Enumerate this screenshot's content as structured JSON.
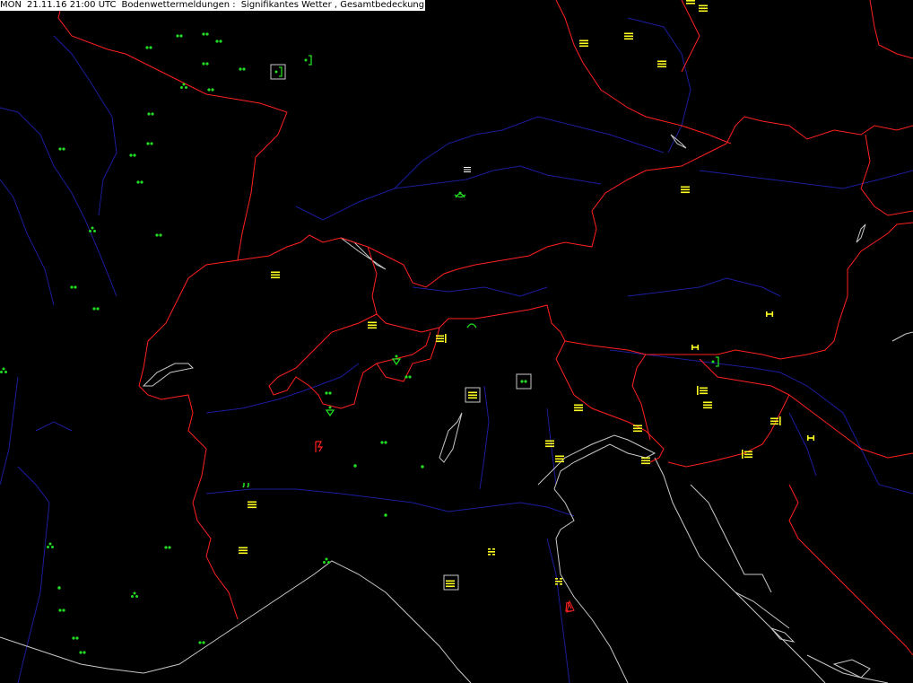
{
  "header": {
    "day": "MON",
    "date_time": "21.11.16 21:00 UTC",
    "product": "Bodenwettermeldungen :",
    "parameters": "Signifikantes Wetter , Gesamtbedeckung"
  },
  "colors": {
    "background": "#000000",
    "country_border": "#ff2020",
    "river": "#1c1c9c",
    "coastline": "#c8c8c8",
    "precip_symbol": "#22dd22",
    "fog_symbol": "#ffff22",
    "thunder_symbol": "#ff2020"
  },
  "legend_notes": {
    "green_symbols": "rain / drizzle / showers",
    "yellow_symbols": "fog / mist",
    "red_symbols": "thunderstorm"
  },
  "stations": [
    {
      "symbol": "drizzle-icon",
      "weather": "drizzle",
      "color": "green"
    },
    {
      "symbol": "fog-icon",
      "weather": "fog",
      "color": "yellow"
    },
    {
      "symbol": "rain-shower-icon",
      "weather": "rain shower",
      "color": "green"
    },
    {
      "symbol": "thunderstorm-icon",
      "weather": "thunderstorm",
      "color": "red"
    }
  ]
}
